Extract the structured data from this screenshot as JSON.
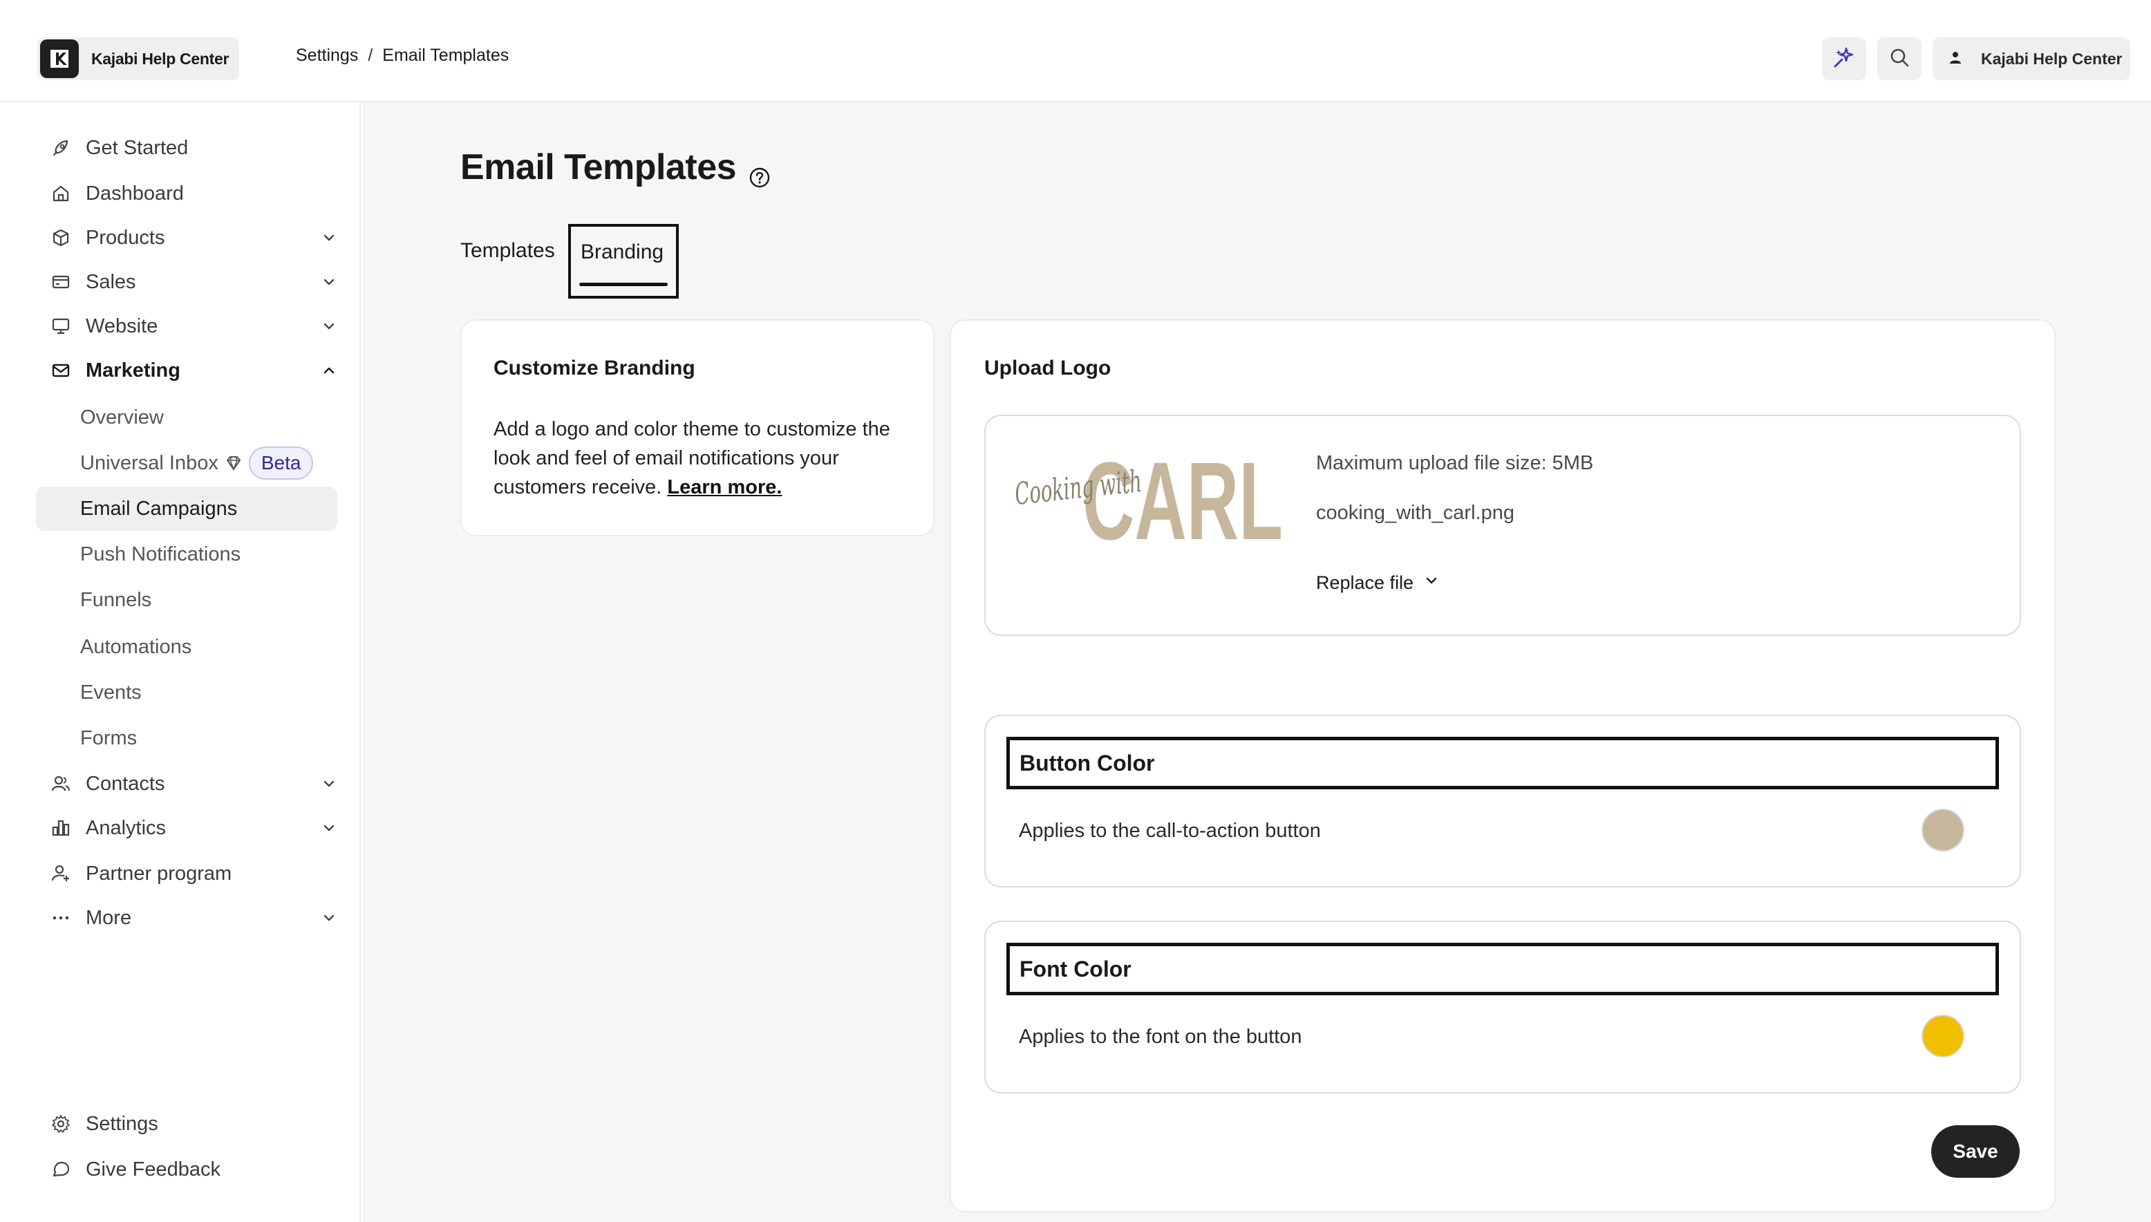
{
  "header": {
    "brand_name": "Kajabi Help Center",
    "breadcrumb": [
      "Settings",
      "Email Templates"
    ],
    "breadcrumb_sep": "/",
    "user_name": "Kajabi Help Center",
    "icons": [
      "sparkle-icon",
      "search-icon",
      "user-icon"
    ]
  },
  "sidebar": {
    "items": [
      {
        "label": "Get Started",
        "icon": "rocket-icon"
      },
      {
        "label": "Dashboard",
        "icon": "home-icon"
      },
      {
        "label": "Products",
        "icon": "box-icon",
        "expandable": true
      },
      {
        "label": "Sales",
        "icon": "credit-card-icon",
        "expandable": true
      },
      {
        "label": "Website",
        "icon": "monitor-icon",
        "expandable": true
      },
      {
        "label": "Marketing",
        "icon": "mail-icon",
        "expandable": true,
        "expanded": true
      },
      {
        "label": "Contacts",
        "icon": "contacts-icon",
        "expandable": true
      },
      {
        "label": "Analytics",
        "icon": "analytics-icon",
        "expandable": true
      },
      {
        "label": "Partner program",
        "icon": "partner-icon"
      },
      {
        "label": "More",
        "icon": "more-icon",
        "expandable": true
      }
    ],
    "marketing_sub": [
      "Overview",
      "Universal Inbox",
      "Email Campaigns",
      "Push Notifications",
      "Funnels",
      "Automations",
      "Events",
      "Forms"
    ],
    "beta_label": "Beta",
    "active_sub": "Email Campaigns",
    "footer": [
      {
        "label": "Settings",
        "icon": "gear-icon"
      },
      {
        "label": "Give Feedback",
        "icon": "chat-icon"
      }
    ]
  },
  "main": {
    "title": "Email Templates",
    "tabs": [
      {
        "label": "Templates",
        "active": false
      },
      {
        "label": "Branding",
        "active": true
      }
    ],
    "customize": {
      "title": "Customize Branding",
      "body": "Add a logo and color theme to customize the look and feel of email notifications your customers receive.",
      "link": "Learn more."
    },
    "upload": {
      "title": "Upload Logo",
      "logo_script": "Cooking with",
      "logo_word": "CARL",
      "max_size": "Maximum upload file size: 5MB",
      "file_name": "cooking_with_carl.png",
      "replace_label": "Replace file"
    },
    "button_color": {
      "title": "Button Color",
      "desc": "Applies to the call-to-action button",
      "color": "#c6b79c"
    },
    "font_color": {
      "title": "Font Color",
      "desc": "Applies to the font on the button",
      "color": "#f0c000"
    },
    "save_label": "Save"
  },
  "colors": {
    "accent": "#3b33c4",
    "page_bg": "#f6f6f6",
    "logo_tan": "#c6b79c"
  }
}
